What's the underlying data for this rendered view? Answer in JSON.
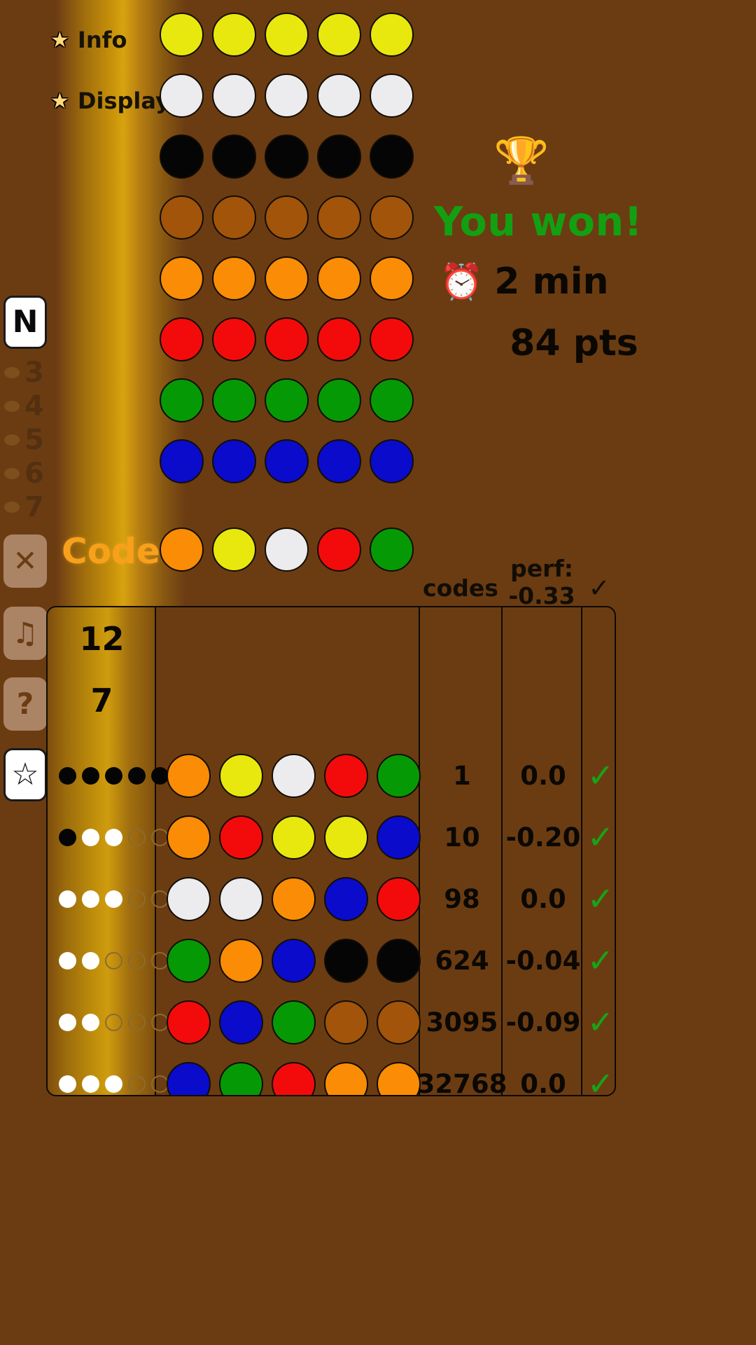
{
  "theme": {
    "background": "#6b3c12",
    "gold": "#c9930a",
    "win_color": "#12a012",
    "code_label_color": "#f9a01b",
    "check_color": "#18a318"
  },
  "menu": {
    "items": [
      {
        "label": "Info",
        "icon": "star-icon"
      },
      {
        "label": "Display",
        "icon": "star-icon"
      }
    ]
  },
  "sidebar": {
    "top_button": {
      "label": "N",
      "name": "n-button",
      "active": true
    },
    "number_items": [
      {
        "label": "3"
      },
      {
        "label": "4"
      },
      {
        "label": "5"
      },
      {
        "label": "6"
      },
      {
        "label": "7"
      }
    ],
    "bottom_buttons": [
      {
        "label": "✕",
        "name": "close-button",
        "active": false
      },
      {
        "label": "♫",
        "name": "music-button",
        "active": false
      },
      {
        "label": "?",
        "name": "help-button",
        "active": false
      },
      {
        "label": "☆",
        "name": "favorite-button",
        "active": true
      }
    ]
  },
  "palette": {
    "rows": [
      [
        "#e8e80f",
        "#e8e80f",
        "#e8e80f",
        "#e8e80f",
        "#e8e80f"
      ],
      [
        "#ececef",
        "#ececef",
        "#ececef",
        "#ececef",
        "#ececef"
      ],
      [
        "#050505",
        "#050505",
        "#050505",
        "#050505",
        "#050505"
      ],
      [
        "#a1540a",
        "#a1540a",
        "#a1540a",
        "#a1540a",
        "#a1540a"
      ],
      [
        "#fb8c05",
        "#fb8c05",
        "#fb8c05",
        "#fb8c05",
        "#fb8c05"
      ],
      [
        "#f30b0b",
        "#f30b0b",
        "#f30b0b",
        "#f30b0b",
        "#f30b0b"
      ],
      [
        "#069906",
        "#069906",
        "#069906",
        "#069906",
        "#069906"
      ],
      [
        "#0b0bcc",
        "#0b0bcc",
        "#0b0bcc",
        "#0b0bcc",
        "#0b0bcc"
      ]
    ]
  },
  "status": {
    "trophy_icon": "🏆",
    "result_text": "You won!",
    "clock_icon": "⏰",
    "time_text": "2 min",
    "points_text": "84 pts"
  },
  "code_row": {
    "label": "Code",
    "colors": [
      "#fb8c05",
      "#e8e80f",
      "#ececef",
      "#f30b0b",
      "#069906"
    ]
  },
  "table": {
    "headers": {
      "codes": "codes",
      "perf_label": "perf:",
      "perf_value": "-0.33",
      "check": "✓"
    },
    "counters": {
      "total": "12",
      "remaining": "7"
    },
    "rows": [
      {
        "pegs": [
          "black",
          "black",
          "black",
          "black",
          "black"
        ],
        "guess": [
          "#fb8c05",
          "#e8e80f",
          "#ececef",
          "#f30b0b",
          "#069906"
        ],
        "codes": "1",
        "perf": "0.0",
        "check": "✓"
      },
      {
        "pegs": [
          "black",
          "white",
          "white",
          "empty",
          "empty"
        ],
        "guess": [
          "#fb8c05",
          "#f30b0b",
          "#e8e80f",
          "#e8e80f",
          "#0b0bcc"
        ],
        "codes": "10",
        "perf": "-0.20",
        "check": "✓"
      },
      {
        "pegs": [
          "white",
          "white",
          "white",
          "empty",
          "empty"
        ],
        "guess": [
          "#ececef",
          "#ececef",
          "#fb8c05",
          "#0b0bcc",
          "#f30b0b"
        ],
        "codes": "98",
        "perf": "0.0",
        "check": "✓"
      },
      {
        "pegs": [
          "white",
          "white",
          "empty",
          "empty",
          "empty"
        ],
        "guess": [
          "#069906",
          "#fb8c05",
          "#0b0bcc",
          "#050505",
          "#050505"
        ],
        "codes": "624",
        "perf": "-0.04",
        "check": "✓"
      },
      {
        "pegs": [
          "white",
          "white",
          "empty",
          "empty",
          "empty"
        ],
        "guess": [
          "#f30b0b",
          "#0b0bcc",
          "#069906",
          "#a1540a",
          "#a1540a"
        ],
        "codes": "3095",
        "perf": "-0.09",
        "check": "✓"
      },
      {
        "pegs": [
          "white",
          "white",
          "white",
          "empty",
          "empty"
        ],
        "guess": [
          "#0b0bcc",
          "#069906",
          "#f30b0b",
          "#fb8c05",
          "#fb8c05"
        ],
        "codes": "32768",
        "perf": "0.0",
        "check": "✓"
      }
    ]
  }
}
